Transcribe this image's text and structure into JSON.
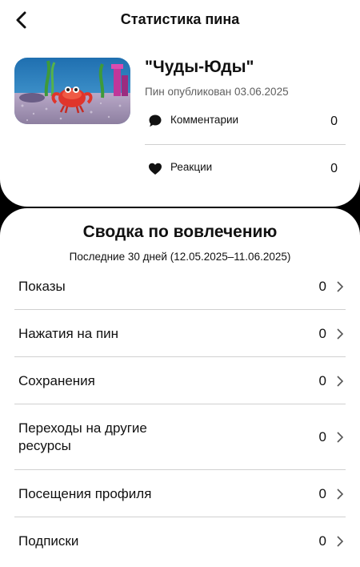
{
  "header": {
    "title": "Статистика пина",
    "back_icon": "chevron-left-icon"
  },
  "pin": {
    "title": "\"Чуды-Юды\"",
    "published": "Пин опубликован 03.06.2025",
    "thumbnail_icon": "crab-aquarium-image"
  },
  "stats": [
    {
      "label": "Комментарии",
      "value": "0",
      "icon": "comment-icon"
    },
    {
      "label": "Реакции",
      "value": "0",
      "icon": "heart-icon"
    }
  ],
  "engagement": {
    "title": "Сводка по вовлечению",
    "period": "Последние 30 дней (12.05.2025–11.06.2025)",
    "items": [
      {
        "label": "Показы",
        "value": "0"
      },
      {
        "label": "Нажатия на пин",
        "value": "0"
      },
      {
        "label": "Сохранения",
        "value": "0"
      },
      {
        "label": "Переходы на другие ресурсы",
        "value": "0"
      },
      {
        "label": "Посещения профиля",
        "value": "0"
      },
      {
        "label": "Подписки",
        "value": "0"
      }
    ]
  },
  "colors": {
    "background": "#000000",
    "card": "#ffffff",
    "text": "#111111",
    "muted": "#5f5f5f",
    "divider": "#d0d0d0"
  }
}
